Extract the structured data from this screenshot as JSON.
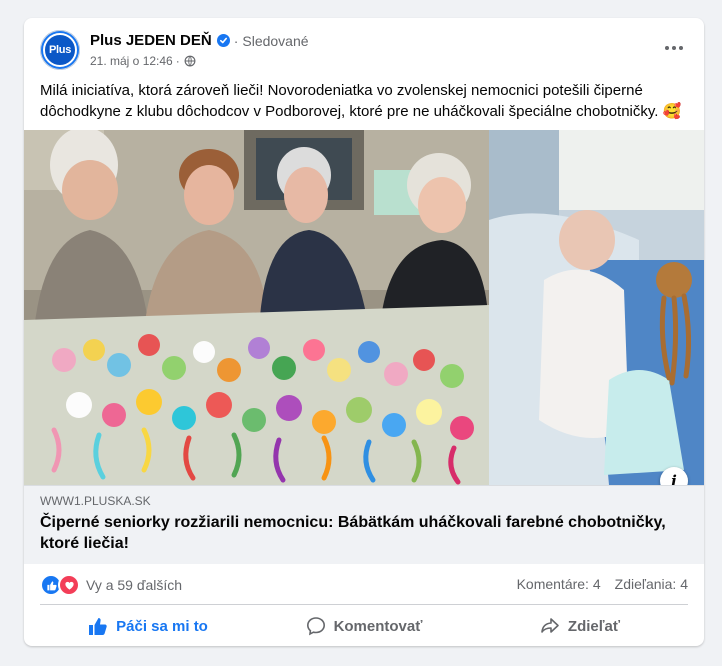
{
  "post": {
    "page_name": "Plus JEDEN DEŇ",
    "follow_state": "Sledované",
    "separator": "·",
    "timestamp": "21. máj o 12:46",
    "meta_separator": "·",
    "avatar_text": "Plus",
    "caption": "Milá iniciatíva, ktorá zároveň lieči! Novorodeniatka vo zvolenskej nemocnici potešili čiperné dôchodkyne z klubu dôchodcov v Podborovej, ktoré pre ne uháčkovali špeciálne chobotničky. 🥰",
    "more_icon": "three-dots-icon"
  },
  "link": {
    "domain": "WWW1.PLUSKA.SK",
    "title": "Čiperné seniorky rozžiarili nemocnicu: Bábätkám uháčkovali farebné chobotničky, ktoré liečia!",
    "info_label": "i"
  },
  "stats": {
    "reactions_text": "Vy a 59 ďalších",
    "comments": "Komentáre: 4",
    "shares": "Zdieľania: 4"
  },
  "actions": {
    "like": "Páči sa mi to",
    "comment": "Komentovať",
    "share": "Zdieľať"
  },
  "colors": {
    "accent": "#1877f2",
    "love": "#f33e58",
    "muted": "#65676b"
  }
}
